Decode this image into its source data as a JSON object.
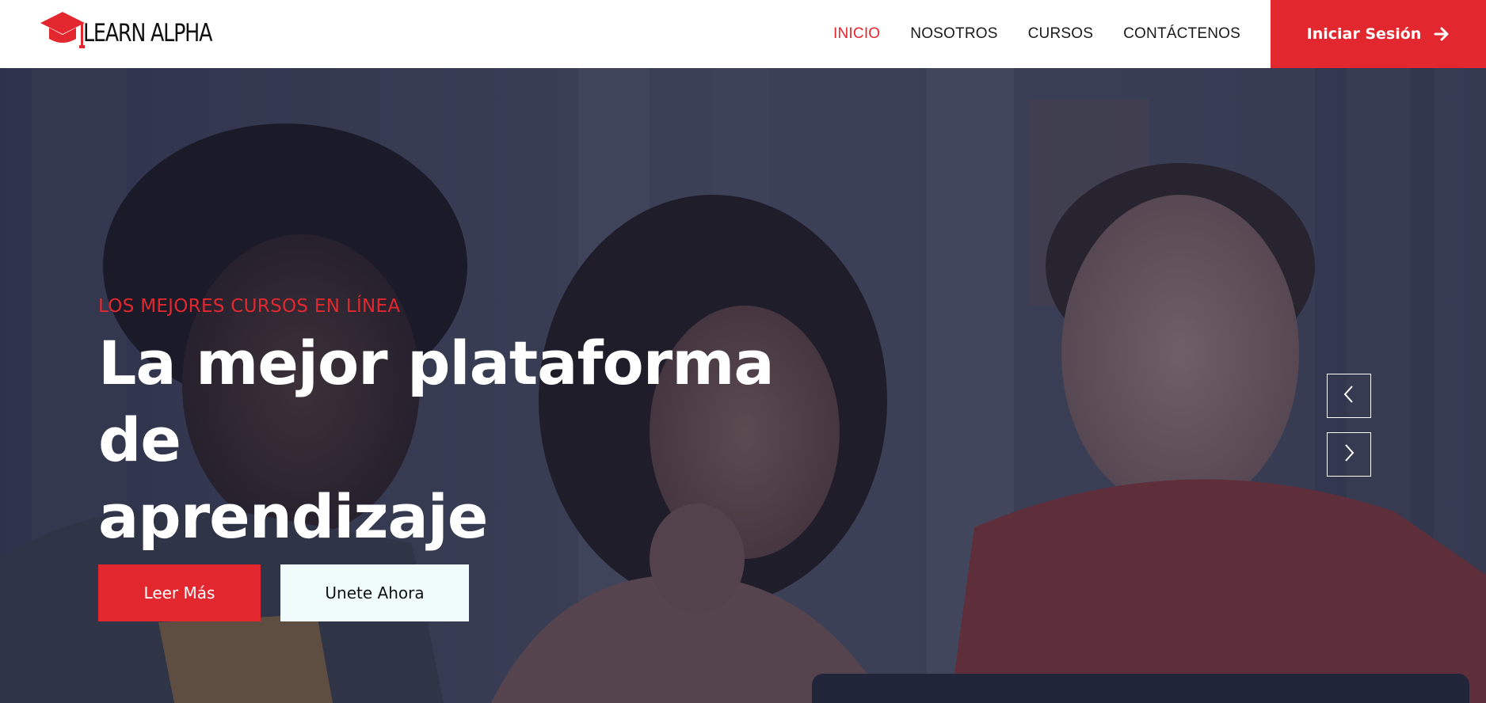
{
  "brand": {
    "name": "LEARN ALPHA",
    "icon": "graduation-cap-icon",
    "accent_color": "#e2282e"
  },
  "nav": {
    "items": [
      {
        "label": "INICIO",
        "active": true
      },
      {
        "label": "NOSOTROS",
        "active": false
      },
      {
        "label": "CURSOS",
        "active": false
      },
      {
        "label": "CONTÁCTENOS",
        "active": false
      }
    ],
    "login_label": "Iniciar Sesión",
    "login_icon": "arrow-right-icon"
  },
  "hero": {
    "eyebrow": "LOS MEJORES CURSOS EN LÍNEA",
    "headline_line1": "La mejor plataforma de",
    "headline_line2": "aprendizaje",
    "primary_button": "Leer Más",
    "secondary_button": "Unete Ahora",
    "prev_icon": "chevron-left-icon",
    "next_icon": "chevron-right-icon"
  }
}
